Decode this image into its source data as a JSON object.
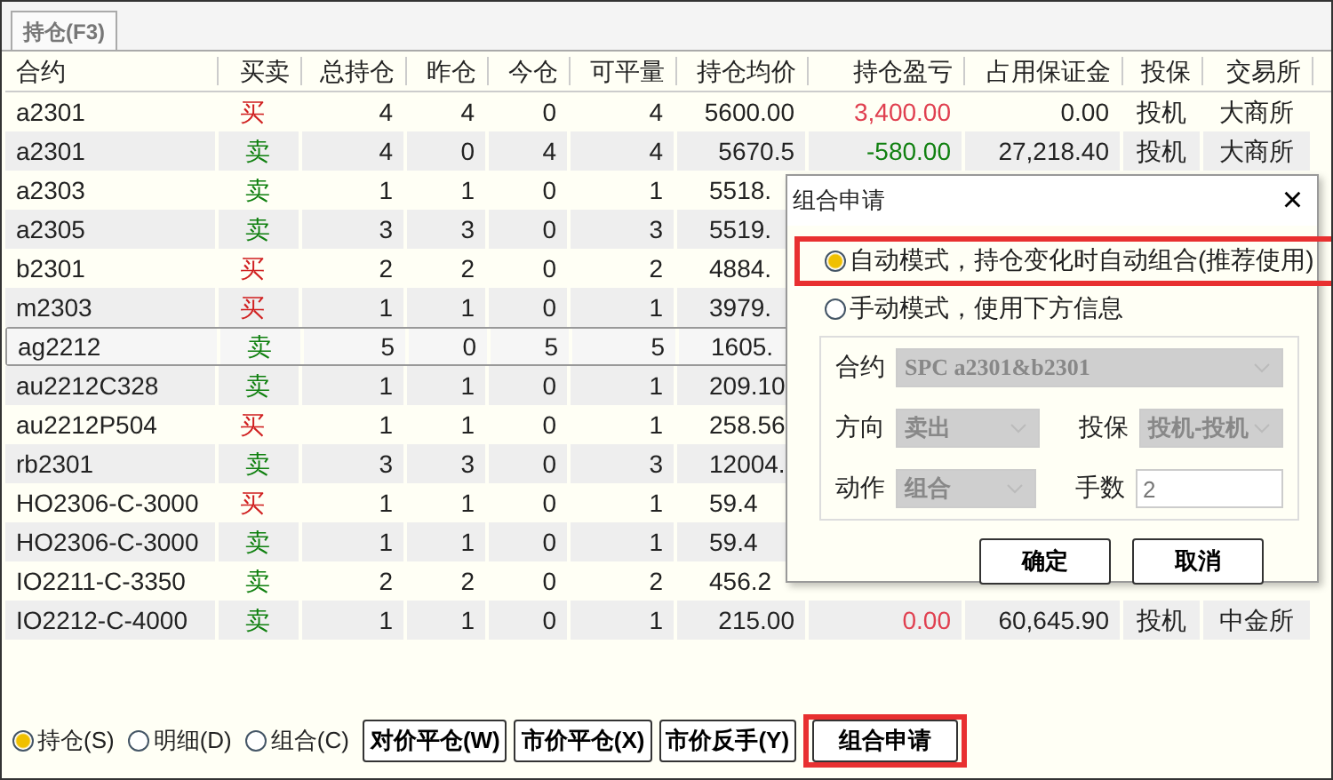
{
  "tabs": [
    {
      "label": "持仓(F3)",
      "selected": true
    }
  ],
  "table": {
    "columns": [
      "合约",
      "买卖",
      "总持仓",
      "昨仓",
      "今仓",
      "可平量",
      "持仓均价",
      "持仓盈亏",
      "占用保证金",
      "投保",
      "交易所"
    ],
    "rows": [
      {
        "selected": false,
        "cells": [
          "a2301",
          {
            "text": "买",
            "kind": "buy",
            "color": "#d02020"
          },
          "4",
          "4",
          "0",
          "4",
          "5600.00",
          {
            "text": "3,400.00",
            "color": "#e04050"
          },
          "0.00",
          "投机",
          "大商所"
        ]
      },
      {
        "selected": false,
        "cells": [
          "a2301",
          {
            "text": "卖",
            "kind": "sell",
            "color": "#108010"
          },
          "4",
          "0",
          "4",
          "4",
          "5670.5",
          {
            "text": "-580.00",
            "color": "#108010"
          },
          "27,218.40",
          "投机",
          "大商所"
        ]
      },
      {
        "selected": false,
        "cells": [
          "a2303",
          {
            "text": "卖",
            "kind": "sell",
            "color": "#108010"
          },
          "1",
          "1",
          "0",
          "1",
          "5518."
        ]
      },
      {
        "selected": false,
        "cells": [
          "a2305",
          {
            "text": "卖",
            "kind": "sell",
            "color": "#108010"
          },
          "3",
          "3",
          "0",
          "3",
          "5519."
        ]
      },
      {
        "selected": false,
        "cells": [
          "b2301",
          {
            "text": "买",
            "kind": "buy",
            "color": "#d02020"
          },
          "2",
          "2",
          "0",
          "2",
          "4884."
        ]
      },
      {
        "selected": false,
        "cells": [
          "m2303",
          {
            "text": "买",
            "kind": "buy",
            "color": "#d02020"
          },
          "1",
          "1",
          "0",
          "1",
          "3979."
        ]
      },
      {
        "selected": true,
        "cells": [
          "ag2212",
          {
            "text": "卖",
            "kind": "sell",
            "color": "#108010"
          },
          "5",
          "0",
          "5",
          "5",
          "1605."
        ]
      },
      {
        "selected": false,
        "cells": [
          "au2212C328",
          {
            "text": "卖",
            "kind": "sell",
            "color": "#108010"
          },
          "1",
          "1",
          "0",
          "1",
          "209.10"
        ]
      },
      {
        "selected": false,
        "cells": [
          "au2212P504",
          {
            "text": "买",
            "kind": "buy",
            "color": "#d02020"
          },
          "1",
          "1",
          "0",
          "1",
          "258.56"
        ]
      },
      {
        "selected": false,
        "cells": [
          "rb2301",
          {
            "text": "卖",
            "kind": "sell",
            "color": "#108010"
          },
          "3",
          "3",
          "0",
          "3",
          "12004."
        ]
      },
      {
        "selected": false,
        "cells": [
          "HO2306-C-3000",
          {
            "text": "买",
            "kind": "buy",
            "color": "#d02020"
          },
          "1",
          "1",
          "0",
          "1",
          "59.4"
        ]
      },
      {
        "selected": false,
        "cells": [
          "HO2306-C-3000",
          {
            "text": "卖",
            "kind": "sell",
            "color": "#108010"
          },
          "1",
          "1",
          "0",
          "1",
          "59.4"
        ]
      },
      {
        "selected": false,
        "cells": [
          "IO2211-C-3350",
          {
            "text": "卖",
            "kind": "sell",
            "color": "#108010"
          },
          "2",
          "2",
          "0",
          "2",
          "456.2"
        ]
      },
      {
        "selected": false,
        "cells": [
          "IO2212-C-4000",
          {
            "text": "卖",
            "kind": "sell",
            "color": "#108010"
          },
          "1",
          "1",
          "0",
          "1",
          "215.00",
          {
            "text": "0.00",
            "color": "#e04050"
          },
          "60,645.90",
          "投机",
          "中金所"
        ]
      }
    ]
  },
  "view_options": [
    {
      "label": "持仓(S)",
      "selected": true
    },
    {
      "label": "明细(D)",
      "selected": false
    },
    {
      "label": "组合(C)",
      "selected": false
    }
  ],
  "buttons": [
    {
      "label": "对价平仓(W)",
      "highlighted": false
    },
    {
      "label": "市价平仓(X)",
      "highlighted": false
    },
    {
      "label": "市价反手(Y)",
      "highlighted": false
    },
    {
      "label": "组合申请",
      "highlighted": true
    }
  ],
  "dialog": {
    "title": "组合申请",
    "close": "×",
    "modes": [
      {
        "label": "自动模式，持仓变化时自动组合(推荐使用)",
        "selected": true,
        "highlighted": true
      },
      {
        "label": "手动模式，使用下方信息",
        "selected": false,
        "highlighted": false
      }
    ],
    "contract": {
      "label": "合约",
      "value": "SPC a2301&b2301",
      "disabled": true
    },
    "direction": {
      "label": "方向",
      "value": "卖出",
      "disabled": true
    },
    "hedge": {
      "label": "投保",
      "value": "投机-投机",
      "disabled": true
    },
    "action": {
      "label": "动作",
      "value": "组合",
      "disabled": true
    },
    "lots": {
      "label": "手数",
      "value": "2"
    },
    "buttons": [
      "确定",
      "取消"
    ]
  }
}
